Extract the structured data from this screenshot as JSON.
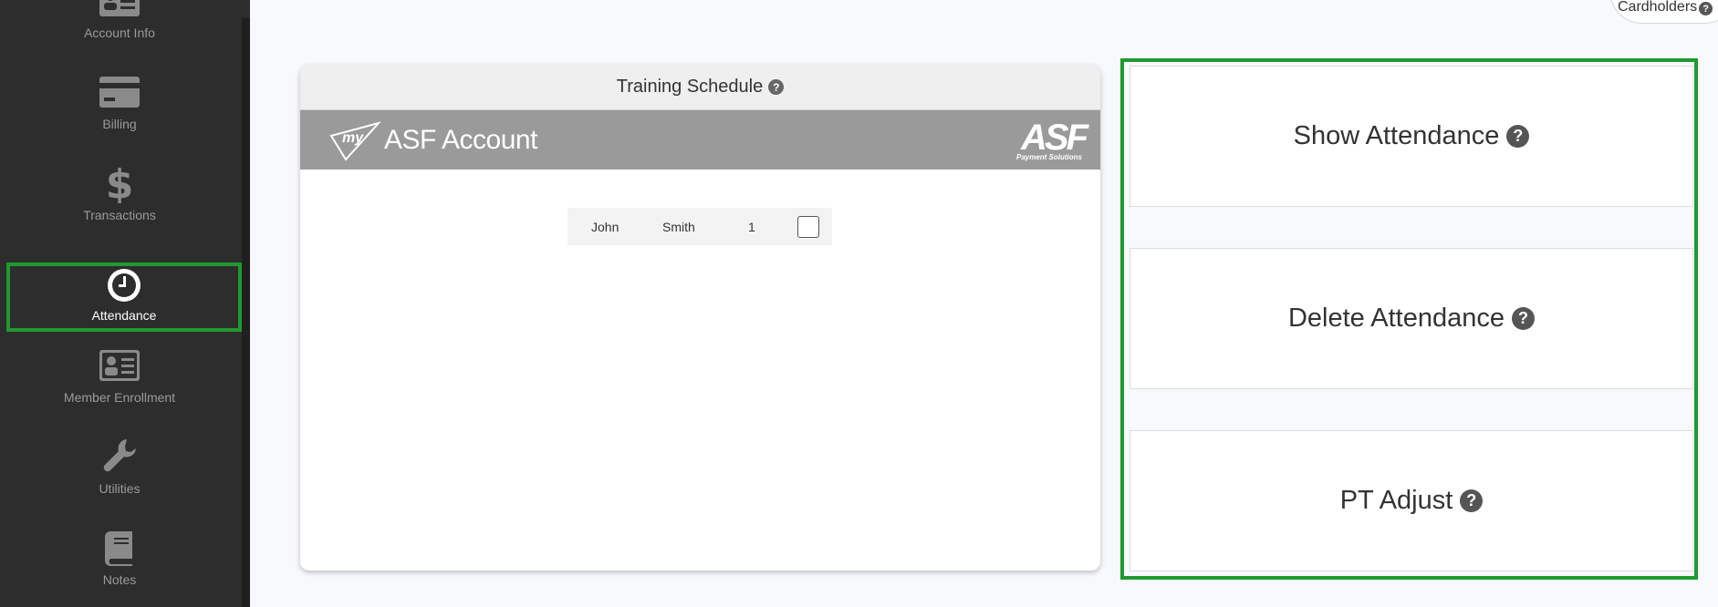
{
  "sidebar": {
    "items": [
      {
        "label": "Account Info",
        "icon": "id-card-icon"
      },
      {
        "label": "Billing",
        "icon": "credit-card-icon"
      },
      {
        "label": "Transactions",
        "icon": "dollar-icon"
      },
      {
        "label": "Attendance",
        "icon": "clock-icon",
        "active": true
      },
      {
        "label": "Member Enrollment",
        "icon": "id-card-icon"
      },
      {
        "label": "Utilities",
        "icon": "wrench-icon"
      },
      {
        "label": "Notes",
        "icon": "notebook-icon"
      }
    ]
  },
  "top": {
    "cardholders_label": "Cardholders",
    "help_glyph": "?"
  },
  "card": {
    "title": "Training Schedule",
    "help_glyph": "?",
    "brand": {
      "prefix": "my",
      "name": "ASF Account",
      "logo_text": "ASF",
      "logo_sub": "Payment Solutions"
    },
    "member": {
      "first": "John",
      "last": "Smith",
      "number": "1"
    }
  },
  "actions": [
    {
      "label": "Show Attendance"
    },
    {
      "label": "Delete Attendance"
    },
    {
      "label": "PT Adjust"
    }
  ],
  "colors": {
    "sidebar_bg": "#2d2d2d",
    "highlight": "#1f9a2e",
    "brand_bar": "#9a9a9a"
  }
}
